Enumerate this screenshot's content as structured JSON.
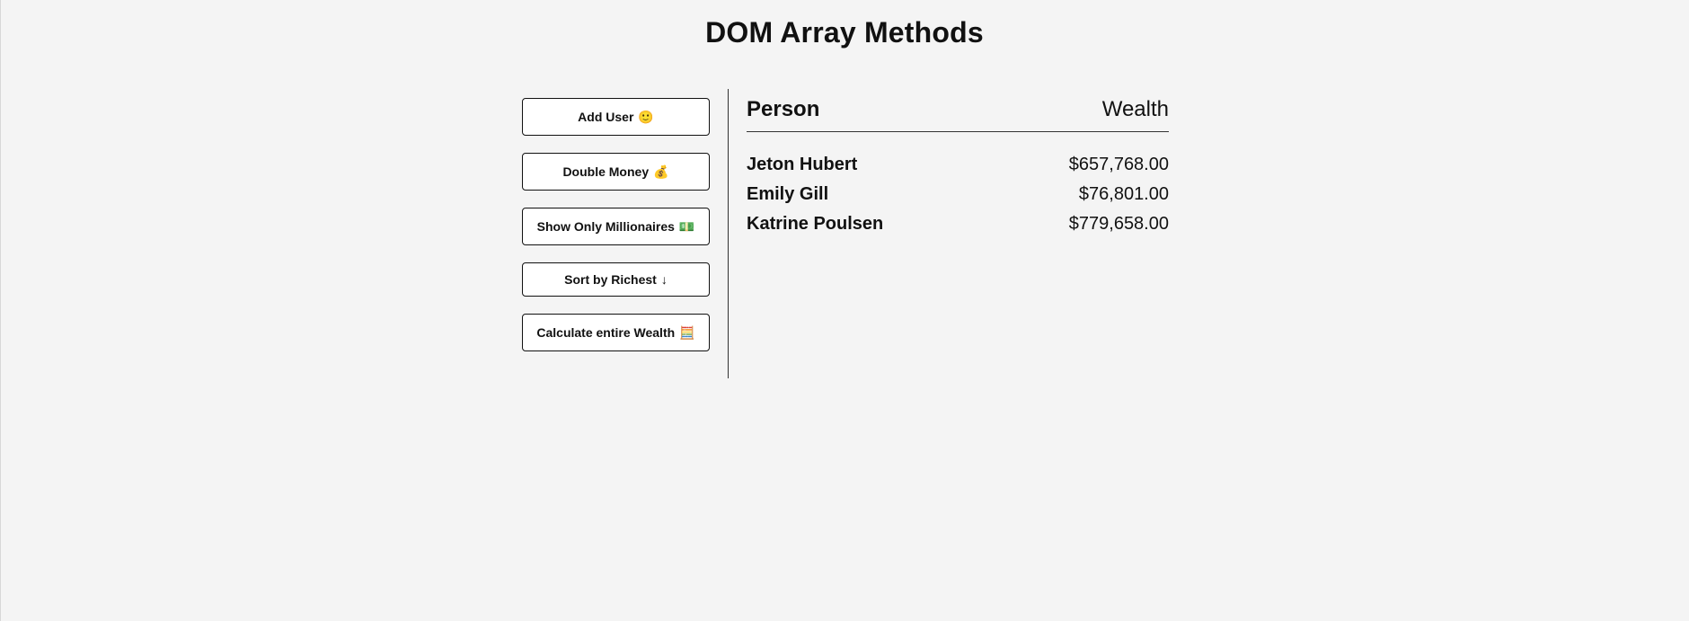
{
  "title": "DOM Array Methods",
  "buttons": [
    {
      "label": "Add User",
      "icon": "🙂",
      "icon_name": "user-face-icon"
    },
    {
      "label": "Double Money",
      "icon": "💰",
      "icon_name": "money-bag-icon"
    },
    {
      "label": "Show Only Millionaires",
      "icon": "💵",
      "icon_name": "banknote-icon"
    },
    {
      "label": "Sort by Richest",
      "icon": "↓",
      "icon_name": "arrow-down-icon"
    },
    {
      "label": "Calculate entire Wealth",
      "icon": "🧮",
      "icon_name": "abacus-icon"
    }
  ],
  "table": {
    "person_header": "Person",
    "wealth_header": "Wealth",
    "rows": [
      {
        "name": "Jeton Hubert",
        "wealth": "$657,768.00"
      },
      {
        "name": "Emily Gill",
        "wealth": "$76,801.00"
      },
      {
        "name": "Katrine Poulsen",
        "wealth": "$779,658.00"
      }
    ]
  },
  "colors": {
    "background": "#f4f4f4",
    "button_background": "#ffffff",
    "text": "#111111",
    "border": "#333333"
  }
}
